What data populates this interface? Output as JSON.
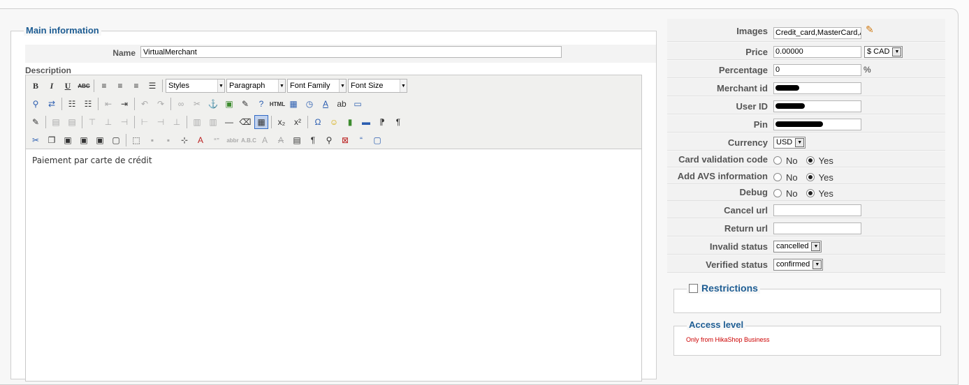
{
  "main": {
    "legend": "Main information",
    "name_label": "Name",
    "name_value": "VirtualMerchant",
    "description_label": "Description",
    "editor": {
      "styles": "Styles",
      "format": "Paragraph",
      "font_family": "Font Family",
      "font_size": "Font Size",
      "content": "Paiement par carte de crédit"
    }
  },
  "right": {
    "images_label": "Images",
    "images_value": "Credit_card,MasterCard,A",
    "price_label": "Price",
    "price_value": "0.00000",
    "price_currency": "$ CAD",
    "percentage_label": "Percentage",
    "percentage_value": "0",
    "percentage_unit": "%",
    "merchant_label": "Merchant id",
    "user_label": "User ID",
    "pin_label": "Pin",
    "currency_label": "Currency",
    "currency_value": "USD",
    "cvc_label": "Card validation code",
    "avs_label": "Add AVS information",
    "debug_label": "Debug",
    "no": "No",
    "yes": "Yes",
    "cancel_label": "Cancel url",
    "return_label": "Return url",
    "invalid_label": "Invalid status",
    "invalid_value": "cancelled",
    "verified_label": "Verified status",
    "verified_value": "confirmed",
    "restrictions_legend": "Restrictions",
    "access_legend": "Access level",
    "access_note": "Only from HikaShop Business"
  }
}
